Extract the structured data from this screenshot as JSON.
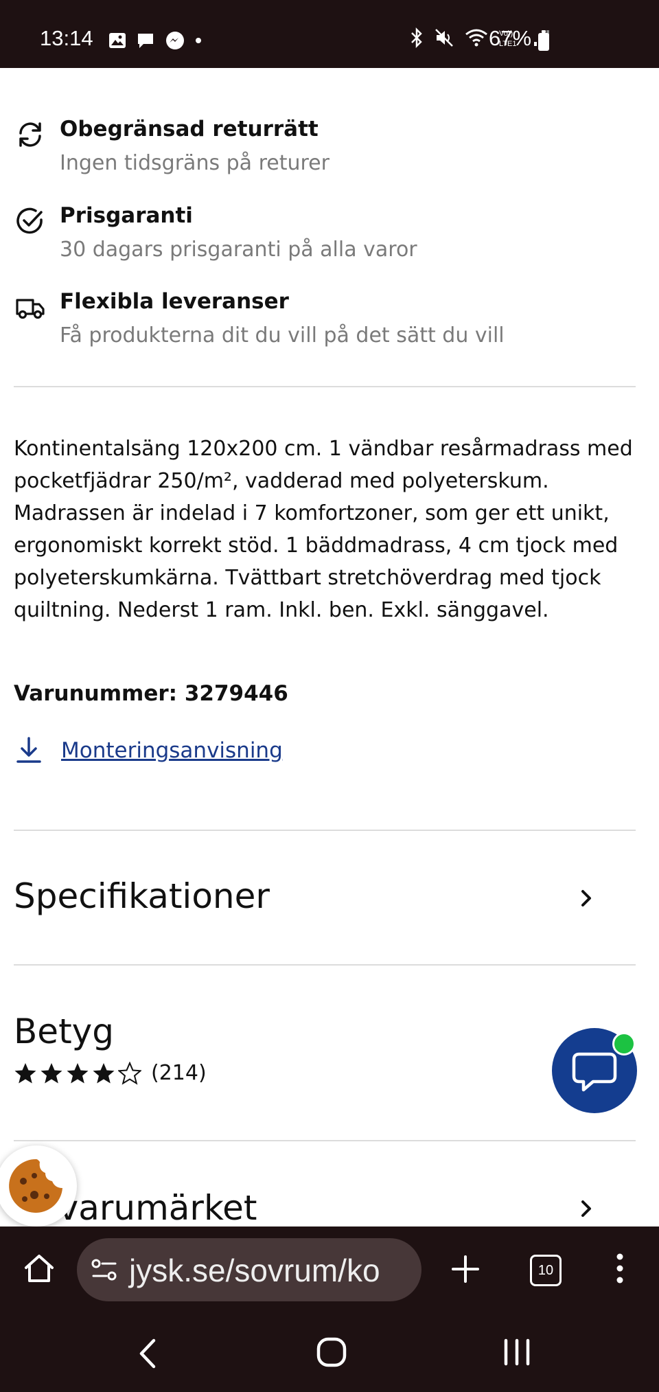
{
  "status_bar": {
    "time": "13:14",
    "battery_percent": "67%",
    "icons_left": [
      "image-icon",
      "chat-icon",
      "messenger-icon",
      "dot-icon"
    ],
    "icons_right": [
      "bluetooth-icon",
      "mute-icon",
      "wifi-icon",
      "volte-icon",
      "signal-icon",
      "battery-icon"
    ],
    "volte_text": "Vo)) LTE1"
  },
  "features": [
    {
      "icon": "refresh-icon",
      "title": "Obegränsad returrätt",
      "subtitle": "Ingen tidsgräns på returer"
    },
    {
      "icon": "check-circle-icon",
      "title": "Prisgaranti",
      "subtitle": "30 dagars prisgaranti på alla varor"
    },
    {
      "icon": "truck-icon",
      "title": "Flexibla leveranser",
      "subtitle": "Få produkterna dit du vill på det sätt du vill"
    }
  ],
  "description": "Kontinentalsäng 120x200 cm. 1 vändbar resårmadrass med pocketfjädrar 250/m², vadderad med polyeterskum. Madrassen är indelad i 7 komfortzoner, som ger ett unikt, ergonomiskt korrekt stöd. 1 bäddmadrass, 4 cm tjock med polyeterskumkärna. Tvättbart stretchöverdrag med tjock quiltning. Nederst 1 ram. Inkl. ben. Exkl. sänggavel.",
  "sku": {
    "label": "Varunummer:",
    "value": "3279446"
  },
  "manual_link": "Monteringsanvisning",
  "sections": {
    "specifications": "Specifikationer",
    "rating_title": "Betyg",
    "rating_count": "(214)",
    "rating_value": 4,
    "rating_max": 5,
    "brand_partial": "m varumärket"
  },
  "browser": {
    "url": "jysk.se/sovrum/ko",
    "tab_count": "10"
  },
  "colors": {
    "status_bg": "#1e1112",
    "link": "#1a3a8a",
    "chat_button": "#143d8f",
    "online_dot": "#1cc242",
    "subtext": "#7a7a7a"
  }
}
